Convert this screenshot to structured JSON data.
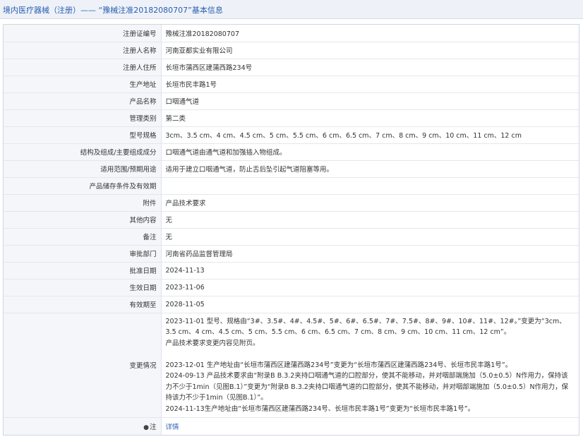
{
  "header": {
    "title": "境内医疗器械（注册）—— “豫械注准20182080707”基本信息"
  },
  "rows": [
    {
      "label": "注册证编号",
      "value": "豫械注准20182080707"
    },
    {
      "label": "注册人名称",
      "value": "河南亚都实业有限公司"
    },
    {
      "label": "注册人住所",
      "value": "长垣市蒲西区建蒲西路234号"
    },
    {
      "label": "生产地址",
      "value": "长垣市民丰路1号"
    },
    {
      "label": "产品名称",
      "value": "口咽通气道"
    },
    {
      "label": "管理类别",
      "value": "第二类"
    },
    {
      "label": "型号规格",
      "value": "3cm、3.5 cm、4 cm、4.5 cm、5 cm、5.5 cm、6 cm、6.5 cm、7 cm、8 cm、9 cm、10 cm、11 cm、12 cm"
    },
    {
      "label": "结构及组成/主要组成成分",
      "value": "口咽通气道由通气道和加强插入物组成。"
    },
    {
      "label": "适用范围/预期用途",
      "value": "适用于建立口咽通气道，防止舌后坠引起气道阻塞等用。"
    },
    {
      "label": "产品储存条件及有效期",
      "value": ""
    },
    {
      "label": "附件",
      "value": "产品技术要求"
    },
    {
      "label": "其他内容",
      "value": "无"
    },
    {
      "label": "备注",
      "value": "无"
    },
    {
      "label": "审批部门",
      "value": "河南省药品监督管理局"
    },
    {
      "label": "批准日期",
      "value": "2024-11-13"
    },
    {
      "label": "生效日期",
      "value": "2023-11-06"
    },
    {
      "label": "有效期至",
      "value": "2028-11-05"
    }
  ],
  "changes": {
    "label": "变更情况",
    "lines": [
      "2023-11-01 型号、规格由“3#、3.5#、4#、4.5#、5#、6#、6.5#、7#、7.5#、8#、9#、10#、11#、12#。”变更为“3cm、3.5 cm、4 cm、4.5 cm、5 cm、5.5 cm、6 cm、6.5 cm、7 cm、8 cm、9 cm、10 cm、11 cm、12 cm”。",
      "产品技术要求变更内容见附页。",
      "",
      "2023-12-01 生产地址由“长垣市蒲西区建蒲西路234号”变更为“长垣市蒲西区建蒲西路234号、长垣市民丰路1号”。",
      "2024-09-13 产品技术要求由“附录B B.3.2夹持口咽通气道的口腔部分，使其不能移动，并对咽部端施加（5.0±0.5）N作用力，保持该力不少于1min（见图B.1）”变更为“附录B B.3.2夹持口咽通气道的口腔部分，使其不能移动，并对咽部端施加（5.0±0.5）N作用力，保持该力不少于1min（见图B.1）”。",
      "2024-11-13生产地址由“长垣市蒲西区建蒲西路234号、长垣市民丰路1号”变更为“长垣市民丰路1号”。"
    ]
  },
  "note": {
    "label": "注",
    "icon": "location-pin-icon",
    "link_text": "详情"
  }
}
